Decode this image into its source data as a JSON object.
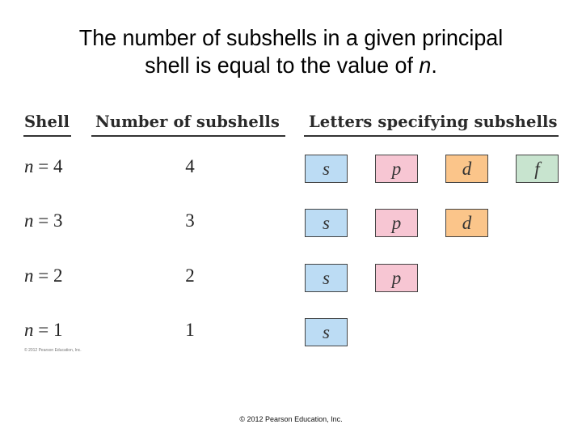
{
  "title": {
    "line1": "The number of subshells in a given principal",
    "line2_prefix": "shell is equal to the value of ",
    "line2_var": "n",
    "line2_suffix": "."
  },
  "headers": {
    "shell": "Shell",
    "count": "Number of subshells",
    "letters": "Letters specifying subshells"
  },
  "colors": {
    "s": "#bcdcf4",
    "p": "#f7c6d3",
    "d": "#fbc58a",
    "f": "#c8e4cf"
  },
  "rows": [
    {
      "var": "n",
      "eq": " = 4",
      "count": "4",
      "subshells": [
        "s",
        "p",
        "d",
        "f"
      ]
    },
    {
      "var": "n",
      "eq": " = 3",
      "count": "3",
      "subshells": [
        "s",
        "p",
        "d"
      ]
    },
    {
      "var": "n",
      "eq": " = 2",
      "count": "2",
      "subshells": [
        "s",
        "p"
      ]
    },
    {
      "var": "n",
      "eq": " = 1",
      "count": "1",
      "subshells": [
        "s"
      ]
    }
  ],
  "copyright_small": "© 2012 Pearson Education, Inc.",
  "copyright_footer": "© 2012 Pearson Education, Inc."
}
